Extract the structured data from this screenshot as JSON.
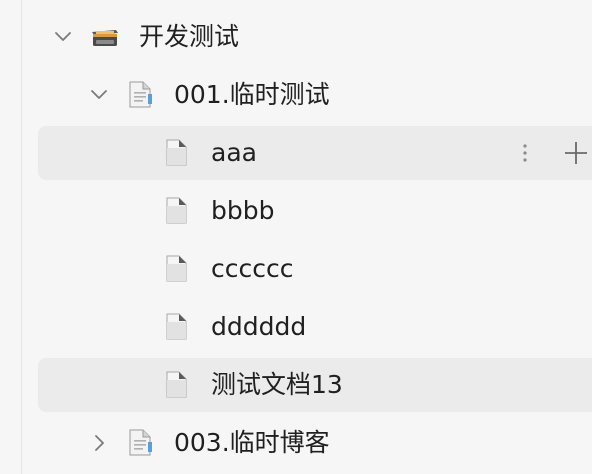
{
  "tree": {
    "root": {
      "label": "开发测试",
      "icon": "cabinet-icon",
      "expanded": true
    },
    "folder_001": {
      "label": "001.临时测试",
      "icon": "folder-doc-icon",
      "expanded": true
    },
    "docs": [
      {
        "label": "aaa",
        "icon": "document-icon",
        "highlighted": true
      },
      {
        "label": "bbbb",
        "icon": "document-icon"
      },
      {
        "label": "cccccc",
        "icon": "document-icon"
      },
      {
        "label": "dddddd",
        "icon": "document-icon"
      },
      {
        "label": "测试文档13",
        "icon": "document-icon",
        "highlighted": true
      }
    ],
    "folder_003": {
      "label": "003.临时博客",
      "icon": "folder-doc-icon",
      "expanded": false
    },
    "row_actions": {
      "more_icon": "more-vertical-icon",
      "add_icon": "plus-icon"
    }
  },
  "colors": {
    "background": "#f6f6f6",
    "highlight": "#ebebeb",
    "text": "#202020",
    "icon_gray": "#8a8a8a"
  }
}
